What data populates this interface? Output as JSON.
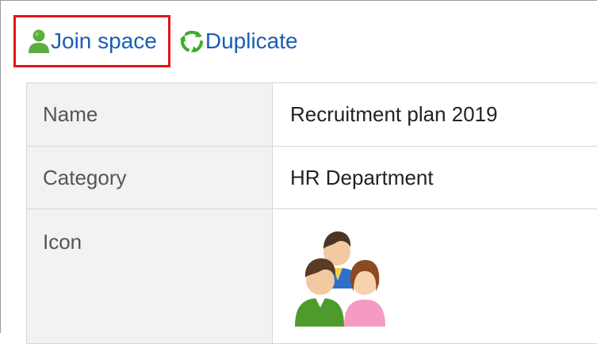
{
  "toolbar": {
    "join_label": "Join space",
    "join_icon": "user-icon",
    "duplicate_label": "Duplicate",
    "duplicate_icon": "recycle-icon",
    "highlight_color": "#e3151a",
    "link_color": "#1a5fb4"
  },
  "details": {
    "rows": [
      {
        "label": "Name",
        "value": "Recruitment plan 2019"
      },
      {
        "label": "Category",
        "value": "HR Department"
      },
      {
        "label": "Icon",
        "value_icon": "group-people-icon"
      }
    ]
  }
}
